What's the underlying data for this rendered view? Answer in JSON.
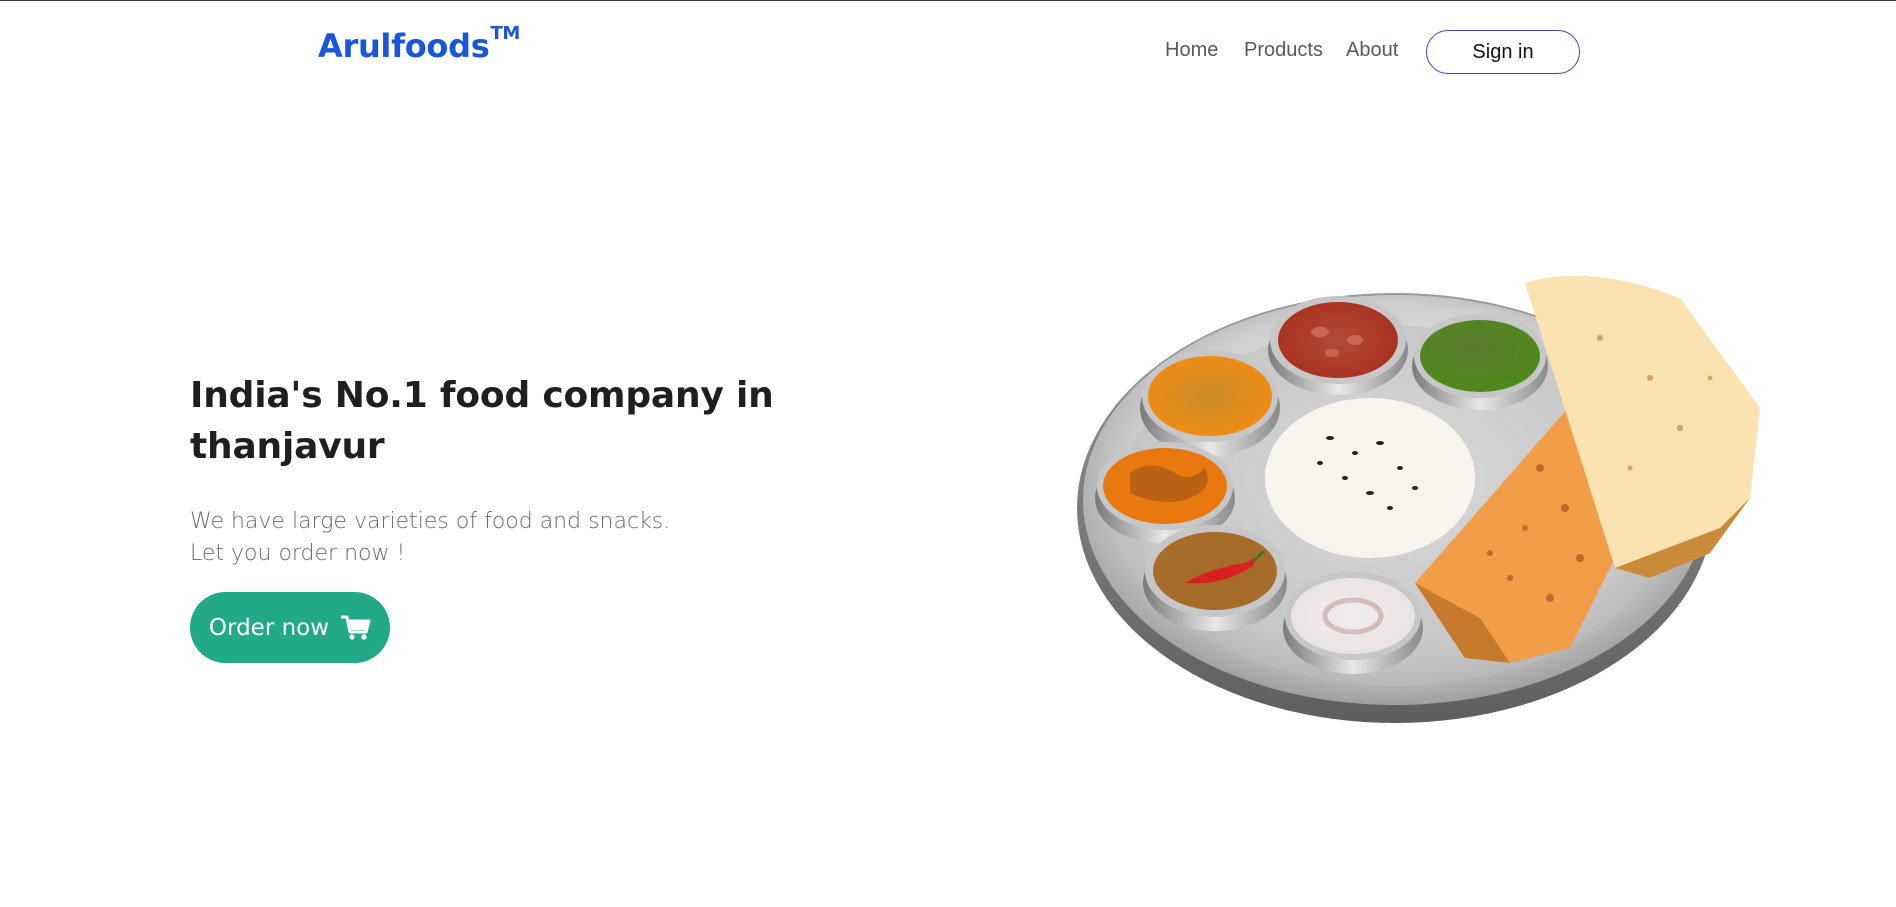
{
  "brand": {
    "name": "Arulfoods",
    "mark": "TM",
    "color": "#1a56db"
  },
  "nav": {
    "links": [
      {
        "label": "Home"
      },
      {
        "label": "Products"
      },
      {
        "label": "About"
      }
    ],
    "signin_label": "Sign in"
  },
  "hero": {
    "title": "India's No.1 food company in thanjavur",
    "subtitle_line1": "We have large varieties of food and snacks.",
    "subtitle_line2": "Let you order now !",
    "cta_label": "Order now",
    "cta_icon": "cart-icon",
    "cta_color": "#22a98a"
  },
  "illustration": {
    "name": "thali-plate-illustration"
  }
}
